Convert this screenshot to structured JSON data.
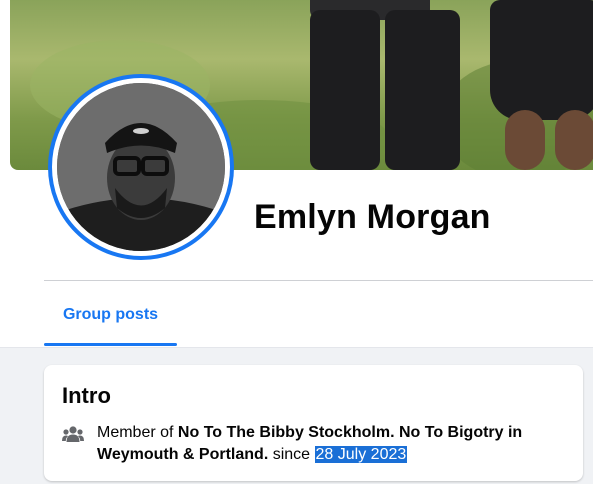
{
  "profile": {
    "name": "Emlyn Morgan"
  },
  "tabs": {
    "group_posts": "Group posts"
  },
  "intro": {
    "title": "Intro",
    "member_prefix": "Member of",
    "group_name": "No To The Bibby Stockholm. No To Bigotry in Weymouth & Portland.",
    "since_word": "since",
    "since_date": "28 July 2023",
    "icon": "group-icon"
  },
  "colors": {
    "accent": "#1877f2",
    "feed_background": "#f0f2f5",
    "selection_highlight": "#1a6fd6"
  }
}
